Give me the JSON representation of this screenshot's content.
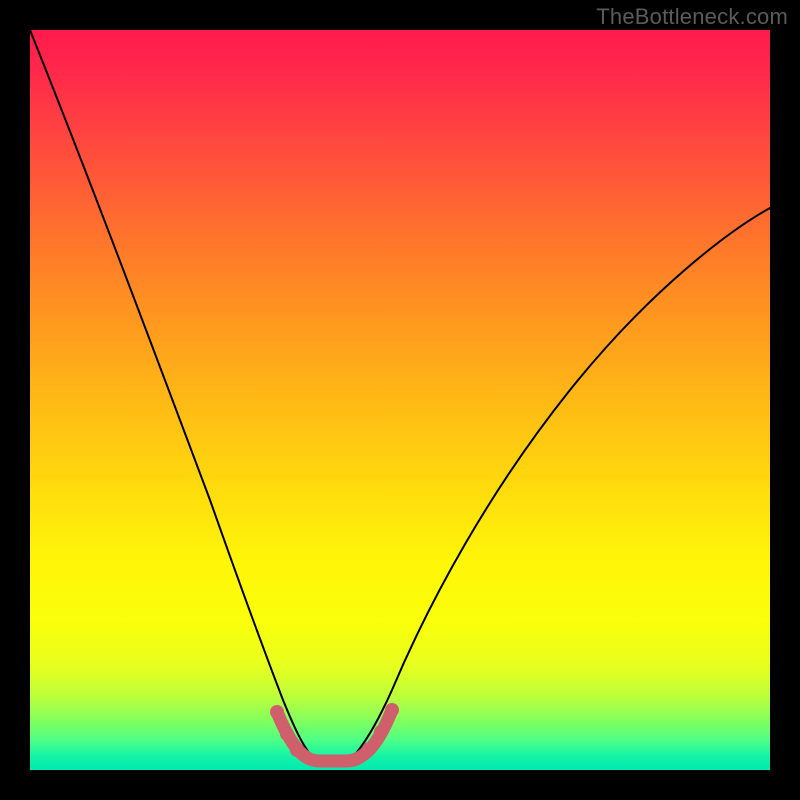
{
  "watermark": {
    "text": "TheBottleneck.com"
  },
  "chart_data": {
    "type": "line",
    "title": "",
    "xlabel": "",
    "ylabel": "",
    "xlim": [
      0,
      100
    ],
    "ylim": [
      0,
      100
    ],
    "grid": false,
    "legend": false,
    "background_gradient": {
      "stops": [
        {
          "pos": 0.0,
          "color": "#ff1a4d"
        },
        {
          "pos": 0.5,
          "color": "#ffc010"
        },
        {
          "pos": 0.8,
          "color": "#faff0a"
        },
        {
          "pos": 1.0,
          "color": "#00e9b0"
        }
      ]
    },
    "series": [
      {
        "name": "bottleneck-curve",
        "stroke": "#000000",
        "stroke_width": 2,
        "x": [
          0,
          5,
          10,
          15,
          20,
          25,
          30,
          33,
          35,
          38,
          41,
          44,
          47,
          50,
          55,
          62,
          70,
          78,
          86,
          94,
          100
        ],
        "values": [
          100,
          82,
          66,
          52,
          42,
          32,
          22,
          14,
          9,
          4,
          1,
          1,
          4,
          9,
          18,
          30,
          42,
          52,
          60,
          66,
          70
        ]
      },
      {
        "name": "optimal-range-marker",
        "stroke": "#cf5f6a",
        "stroke_width": 12,
        "x": [
          33,
          35,
          37,
          38,
          41,
          44,
          46,
          47,
          50
        ],
        "values": [
          14,
          9,
          5,
          4,
          2,
          2,
          4,
          5,
          9
        ]
      }
    ],
    "annotations": [
      {
        "text": "TheBottleneck.com",
        "position": "top-right",
        "color": "#5b5b5b"
      }
    ]
  }
}
